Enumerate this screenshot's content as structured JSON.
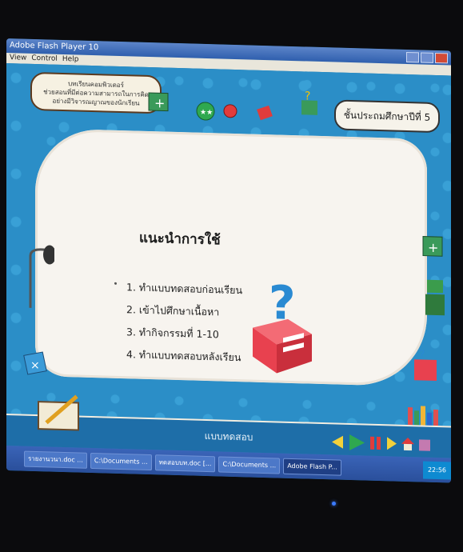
{
  "window": {
    "title": "Adobe Flash Player 10"
  },
  "menu": [
    "View",
    "Control",
    "Help"
  ],
  "banner": {
    "lines": [
      "บทเรียนคอมพิวเตอร์",
      "ช่วยสอนที่มีต่อความสามารถในการคิด",
      "อย่างมีวิจารณญาณของนักเรียน"
    ]
  },
  "grade_label": "ชั้นประถมศึกษาปีที่ 5",
  "content": {
    "heading": "แนะนำการใช้",
    "steps": [
      "1. ทำแบบทดสอบก่อนเรียน",
      "2. เข้าไปศึกษาเนื้อหา",
      "3. ทำกิจกรรมที่ 1-10",
      "4. ทำแบบทดสอบหลังเรียน"
    ]
  },
  "bottom_label": "แบบทดสอบ",
  "taskbar": {
    "tasks": [
      "รายงานวนา.doc ...",
      "C:\\Documents ...",
      "ทดสอบบท.doc [...",
      "C:\\Documents ...",
      "Adobe Flash P..."
    ],
    "clock": "22:56"
  },
  "colors": {
    "stage": "#2b8ec7",
    "board": "#f7f4ef",
    "taskbar": "#3a64b8",
    "cube": "#e8414f"
  }
}
